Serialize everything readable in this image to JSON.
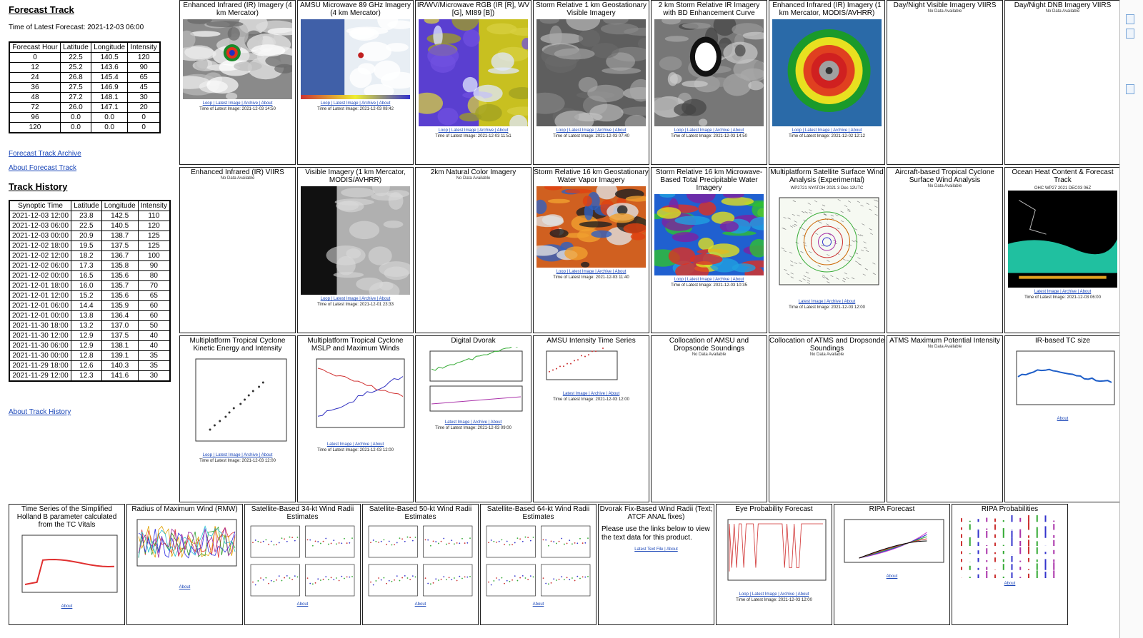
{
  "forecast": {
    "heading": "Forecast Track",
    "time_line": "Time of Latest Forecast: 2021-12-03 06:00",
    "columns": [
      "Forecast Hour",
      "Latitude",
      "Longitude",
      "Intensity"
    ],
    "rows": [
      [
        "0",
        "22.5",
        "140.5",
        "120"
      ],
      [
        "12",
        "25.2",
        "143.6",
        "90"
      ],
      [
        "24",
        "26.8",
        "145.4",
        "65"
      ],
      [
        "36",
        "27.5",
        "146.9",
        "45"
      ],
      [
        "48",
        "27.2",
        "148.1",
        "30"
      ],
      [
        "72",
        "26.0",
        "147.1",
        "20"
      ],
      [
        "96",
        "0.0",
        "0.0",
        "0"
      ],
      [
        "120",
        "0.0",
        "0.0",
        "0"
      ]
    ],
    "archive_link": "Forecast Track Archive",
    "about_link": "About Forecast Track"
  },
  "history": {
    "heading": "Track History",
    "columns": [
      "Synoptic Time",
      "Latitude",
      "Longitude",
      "Intensity"
    ],
    "rows": [
      [
        "2021-12-03 12:00",
        "23.8",
        "142.5",
        "110"
      ],
      [
        "2021-12-03 06:00",
        "22.5",
        "140.5",
        "120"
      ],
      [
        "2021-12-03 00:00",
        "20.9",
        "138.7",
        "125"
      ],
      [
        "2021-12-02 18:00",
        "19.5",
        "137.5",
        "125"
      ],
      [
        "2021-12-02 12:00",
        "18.2",
        "136.7",
        "100"
      ],
      [
        "2021-12-02 06:00",
        "17.3",
        "135.8",
        "90"
      ],
      [
        "2021-12-02 00:00",
        "16.5",
        "135.6",
        "80"
      ],
      [
        "2021-12-01 18:00",
        "16.0",
        "135.7",
        "70"
      ],
      [
        "2021-12-01 12:00",
        "15.2",
        "135.6",
        "65"
      ],
      [
        "2021-12-01 06:00",
        "14.4",
        "135.9",
        "60"
      ],
      [
        "2021-12-01 00:00",
        "13.8",
        "136.4",
        "60"
      ],
      [
        "2021-11-30 18:00",
        "13.2",
        "137.0",
        "50"
      ],
      [
        "2021-11-30 12:00",
        "12.9",
        "137.5",
        "40"
      ],
      [
        "2021-11-30 06:00",
        "12.9",
        "138.1",
        "40"
      ],
      [
        "2021-11-30 00:00",
        "12.8",
        "139.1",
        "35"
      ],
      [
        "2021-11-29 18:00",
        "12.6",
        "140.3",
        "35"
      ],
      [
        "2021-11-29 12:00",
        "12.3",
        "141.6",
        "30"
      ]
    ],
    "about_link": "About Track History"
  },
  "products": {
    "r1": [
      {
        "title": "Enhanced Infrared (IR) Imagery (4 km Mercator)",
        "links": "Loop | Latest Image | Archive | About",
        "time": "Time of Latest Image: 2021-12-03 14:50"
      },
      {
        "title": "AMSU Microwave 89 GHz Imagery (4 km Mercator)",
        "links": "Loop | Latest Image | Archive | About",
        "time": "Time of Latest Image: 2021-12-03 08:42"
      },
      {
        "title": "IR/WV/Microwave RGB (IR [R], WV [G], MI89 [B])",
        "links": "Loop | Latest Image | Archive | About",
        "time": "Time of Latest Image: 2021-12-03 11:51"
      },
      {
        "title": "Storm Relative 1 km Geostationary Visible Imagery",
        "links": "Loop | Latest Image | Archive | About",
        "time": "Time of Latest Image: 2021-12-03 07:40"
      },
      {
        "title": "2 km Storm Relative IR Imagery with BD Enhancement Curve",
        "links": "Loop | Latest Image | Archive | About",
        "time": "Time of Latest Image: 2021-12-03 14:50"
      },
      {
        "title": "Enhanced Infrared (IR) Imagery (1 km Mercator, MODIS/AVHRR)",
        "links": "Loop | Latest Image | Archive | About",
        "time": "Time of Latest Image: 2021-12-02 12:12"
      },
      {
        "title": "Day/Night Visible Imagery VIIRS",
        "nodata": "No Data Available"
      },
      {
        "title": "Day/Night DNB Imagery VIIRS",
        "nodata": "No Data Available"
      }
    ],
    "r2": [
      {
        "title": "Enhanced Infrared (IR) VIIRS",
        "nodata": "No Data Available"
      },
      {
        "title": "Visible Imagery (1 km Mercator, MODIS/AVHRR)",
        "links": "Loop | Latest Image | Archive | About",
        "time": "Time of Latest Image: 2021-12-01 23:33"
      },
      {
        "title": "2km Natural Color Imagery",
        "nodata": "No Data Available"
      },
      {
        "title": "Storm Relative 16 km Geostationary Water Vapor Imagery",
        "links": "Loop | Latest Image | Archive | About",
        "time": "Time of Latest Image: 2021-12-03 11:40"
      },
      {
        "title": "Storm Relative 16 km Microwave-Based Total Precipitable Water Imagery",
        "links": "Loop | Latest Image | Archive | About",
        "time": "Time of Latest Image: 2021-12-03 10:35"
      },
      {
        "title": "Multiplatform Satellite Surface Wind Analysis (Experimental)",
        "links": "Latest Image | Archive | About",
        "time": "Time of Latest Image: 2021-12-03 12:00",
        "img_label": "WP2721   NYATOH  2021   3 Dec 12UTC"
      },
      {
        "title": "Aircraft-based Tropical Cyclone Surface Wind Analysis",
        "nodata": "No Data Available"
      },
      {
        "title": "Ocean Heat Content & Forecast Track",
        "links": "Latest Image | Archive | About",
        "time": "Time of Latest Image: 2021-12-03 06:00",
        "img_label": "OHC   WP27  2021  DEC03  06Z"
      }
    ],
    "r3": [
      {
        "title": "Multiplatform Tropical Cyclone Kinetic Energy and Intensity",
        "links": "Loop | Latest Image | Archive | About",
        "time": "Time of Latest Image: 2021-12-03 12:00"
      },
      {
        "title": "Multiplatform Tropical Cyclone MSLP and Maximum Winds",
        "links": "Latest Image | Archive | About",
        "time": "Time of Latest Image: 2021-12-03 12:00"
      },
      {
        "title": "Digital Dvorak",
        "links": "Latest Image | Archive | About",
        "time": "Time of Latest Image: 2021-12-03 09:00"
      },
      {
        "title": "AMSU Intensity Time Series",
        "links": "Latest Image | Archive | About",
        "time": "Time of Latest Image: 2021-12-03 12:00"
      },
      {
        "title": "Collocation of AMSU and Dropsonde Soundings",
        "nodata": "No Data Available"
      },
      {
        "title": "Collocation of ATMS and Dropsonde Soundings",
        "nodata": "No Data Available"
      },
      {
        "title": "ATMS Maximum Potential Intensity",
        "nodata": "No Data Available"
      },
      {
        "title": "IR-based TC size",
        "links": "About"
      }
    ],
    "r4": [
      {
        "title": "Time Series of the Simplified Holland B parameter calculated from the TC Vitals",
        "links": "About"
      },
      {
        "title": "Radius of Maximum Wind (RMW)",
        "links": "About"
      },
      {
        "title": "Satellite-Based 34-kt Wind Radii Estimates",
        "links": "About"
      },
      {
        "title": "Satellite-Based 50-kt Wind Radii Estimates",
        "links": "About"
      },
      {
        "title": "Satellite-Based 64-kt Wind Radii Estimates",
        "links": "About"
      },
      {
        "title": "Dvorak Fix-Based Wind Radii (Text; ATCF ANAL fixes)",
        "body": "Please use the links below to view the text data for this product.",
        "links": "Latest Text File | About"
      },
      {
        "title": "Eye Probability Forecast",
        "links": "Loop | Latest Image | Archive | About",
        "time": "Time of Latest Image: 2021-12-03 12:00"
      },
      {
        "title": "RIPA Forecast",
        "links": "About"
      },
      {
        "title": "RIPA Probabilities",
        "links": "About"
      }
    ]
  }
}
